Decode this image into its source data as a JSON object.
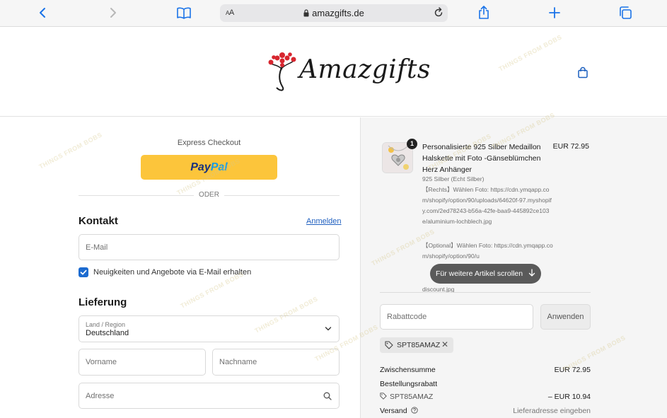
{
  "browser": {
    "text_size_label": "AA",
    "url": "amazgifts.de"
  },
  "header": {
    "brand": "Amazgifts"
  },
  "checkout": {
    "express_label": "Express Checkout",
    "paypal_part1": "Pay",
    "paypal_part2": "Pal",
    "or_label": "ODER",
    "contact_heading": "Kontakt",
    "login_link": "Anmelden",
    "email_placeholder": "E-Mail",
    "newsletter_label": "Neuigkeiten und Angebote via E-Mail erhalten",
    "newsletter_checked": true,
    "delivery_heading": "Lieferung",
    "country_label": "Land / Region",
    "country_value": "Deutschland",
    "first_name_placeholder": "Vorname",
    "last_name_placeholder": "Nachname",
    "address_placeholder": "Adresse"
  },
  "order": {
    "item": {
      "quantity": "1",
      "title": "Personalisierte 925 Silber Medaillon Halskette mit Foto -Gänseblümchen Herz Anhänger",
      "price": "EUR 72.95",
      "variant": "925 Silber (Echt Silber)",
      "detail1": "【Rechts】Wählen Foto: https://cdn.ymqapp.com/shopify/option/90/uploads/64620f-97.myshopify.com/2ed78243-b56a-42fe-baa9-445892ce103e/aluminium-lochblech.jpg",
      "detail2": "【Optional】Wählen Foto: https://cdn.ymqapp.com/shopify/option/90/u",
      "detail3": "discount.jpg"
    },
    "scroll_hint": "Für weitere Artikel scrollen",
    "discount_placeholder": "Rabattcode",
    "apply_label": "Anwenden",
    "applied_code": "SPT85AMAZ",
    "subtotal_label": "Zwischensumme",
    "subtotal_value": "EUR 72.95",
    "order_discount_label": "Bestellungsrabatt",
    "order_discount_code": "SPT85AMAZ",
    "order_discount_value": "– EUR 10.94",
    "shipping_label": "Versand",
    "shipping_value": "Lieferadresse eingeben"
  },
  "watermark_text": "THINGS FROM BOBS",
  "colors": {
    "paypal_yellow": "#fcc53b",
    "link_blue": "#1f5fbf",
    "checkbox_blue": "#1c6bd0",
    "brand_red": "#d7262f"
  }
}
